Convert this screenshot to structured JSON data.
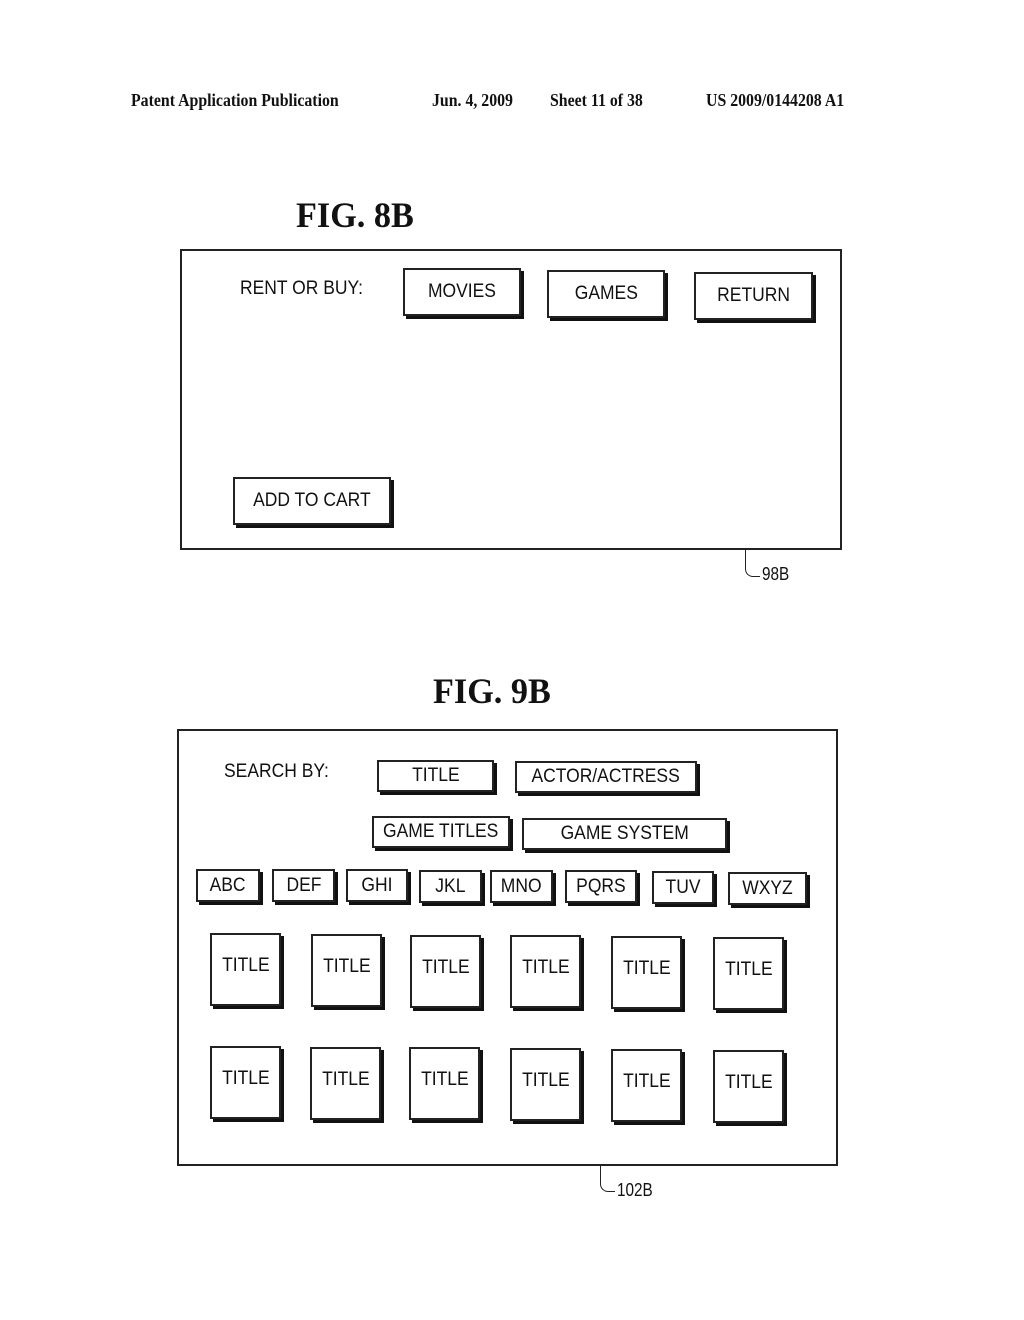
{
  "header": {
    "publication": "Patent Application Publication",
    "date": "Jun. 4, 2009",
    "sheet": "Sheet 11 of 38",
    "number": "US 2009/0144208 A1"
  },
  "fig8b": {
    "title": "FIG. 8B",
    "label": "RENT OR BUY:",
    "buttons": [
      "MOVIES",
      "GAMES",
      "RETURN"
    ],
    "add_to_cart": "ADD TO CART",
    "reference": "98B"
  },
  "fig9b": {
    "title": "FIG. 9B",
    "search_label": "SEARCH BY:",
    "search_buttons": [
      "TITLE",
      "ACTOR/ACTRESS",
      "GAME TITLES",
      "GAME SYSTEM"
    ],
    "letter_buttons": [
      "ABC",
      "DEF",
      "GHI",
      "JKL",
      "MNO",
      "PQRS",
      "TUV",
      "WXYZ"
    ],
    "title_rows": [
      [
        "TITLE",
        "TITLE",
        "TITLE",
        "TITLE",
        "TITLE",
        "TITLE"
      ],
      [
        "TITLE",
        "TITLE",
        "TITLE",
        "TITLE",
        "TITLE",
        "TITLE"
      ]
    ],
    "reference": "102B"
  }
}
